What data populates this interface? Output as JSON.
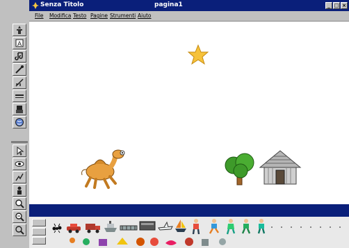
{
  "window": {
    "app_title": "Senza Titolo",
    "doc_title": "pagina1"
  },
  "menu": [
    "File",
    "Modifica",
    "Testo",
    "Pagine",
    "Strumenti",
    "Aiuto"
  ],
  "palette_tools": [
    "stamp-tool-icon",
    "text-tool-icon",
    "sound-tool-icon",
    "magic-wand-icon",
    "brush-tool-icon",
    "line-tool-icon",
    "robot-tool-icon",
    "globe-tool-icon",
    "pointer-tool-icon",
    "eye-tool-icon",
    "draw-tool-icon",
    "person-tool-icon",
    "zoom-in-icon",
    "zoom-out-icon"
  ],
  "canvas_stickers": [
    "star-sticker",
    "camel-sticker",
    "tree-sticker",
    "hut-sticker"
  ],
  "sticker_tray": [
    "ant-sticker-icon",
    "car-sticker-icon",
    "truck-sticker-icon",
    "ship-sticker-icon",
    "train-sticker-icon",
    "shoe-sticker-icon",
    "sailboat-sticker-icon",
    "person-sticker-icon",
    "runner-sticker-icon",
    "dancer-sticker-icon",
    "child-sticker-icon"
  ],
  "colors": {
    "titlebar": "#0a1f7a",
    "canvas": "#ffffff",
    "tray": "#e9e9e9"
  }
}
